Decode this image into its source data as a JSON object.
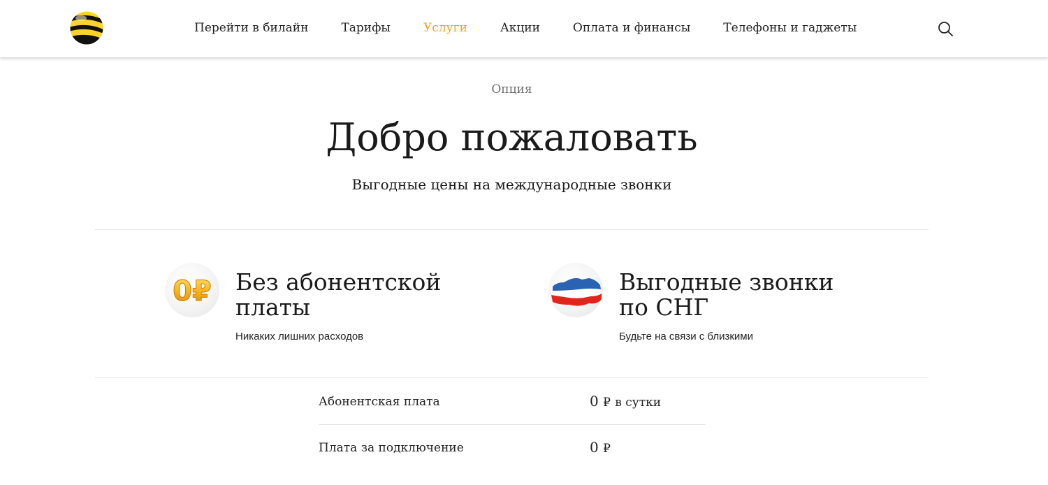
{
  "header": {
    "logo_name": "beeline-logo",
    "nav": [
      {
        "label": "Перейти в билайн",
        "active": false
      },
      {
        "label": "Тарифы",
        "active": false
      },
      {
        "label": "Услуги",
        "active": true
      },
      {
        "label": "Акции",
        "active": false
      },
      {
        "label": "Оплата и финансы",
        "active": false
      },
      {
        "label": "Телефоны и гаджеты",
        "active": false
      }
    ],
    "search_icon": "search-icon"
  },
  "hero": {
    "kicker": "Опция",
    "title": "Добро пожаловать",
    "subtitle": "Выгодные цены на международные звонки"
  },
  "features": [
    {
      "icon": "zero-ruble-coin-icon",
      "icon_text": "0₽",
      "title": "Без абонентской платы",
      "description": "Никаких лишних расходов"
    },
    {
      "icon": "russia-map-icon",
      "title": "Выгодные звонки по СНГ",
      "description": "Будьте на связи с близкими"
    }
  ],
  "pricing": [
    {
      "label": "Абонентская плата",
      "amount": "0",
      "currency": "₽",
      "period": "в сутки"
    },
    {
      "label": "Плата за подключение",
      "amount": "0",
      "currency": "₽",
      "period": ""
    }
  ],
  "colors": {
    "accent": "#f0a323",
    "brand_yellow": "#fcd22b",
    "brand_black": "#1a1a1a",
    "divider": "#e6e6e6"
  }
}
